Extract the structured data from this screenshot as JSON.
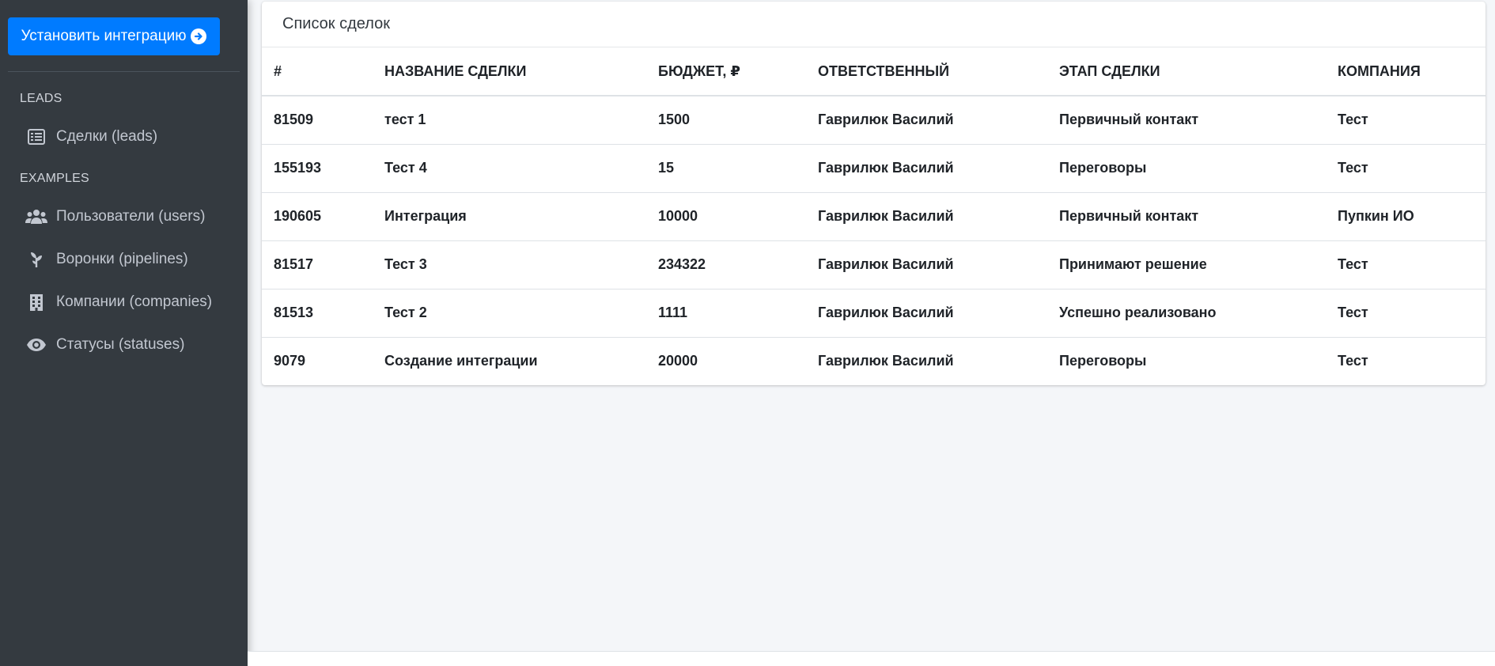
{
  "sidebar": {
    "install_button": "Установить интеграцию",
    "sections": [
      {
        "header": "LEADS",
        "items": [
          {
            "label": "Сделки (leads)",
            "icon": "list-icon"
          }
        ]
      },
      {
        "header": "EXAMPLES",
        "items": [
          {
            "label": "Пользователи (users)",
            "icon": "users-icon"
          },
          {
            "label": "Воронки (pipelines)",
            "icon": "seedling-icon"
          },
          {
            "label": "Компании (companies)",
            "icon": "building-icon"
          },
          {
            "label": "Статусы (statuses)",
            "icon": "eye-icon"
          }
        ]
      }
    ]
  },
  "main": {
    "card_title": "Список сделок",
    "columns": [
      "#",
      "НАЗВАНИЕ СДЕЛКИ",
      "БЮДЖЕТ, ₽",
      "ОТВЕТСТВЕННЫЙ",
      "ЭТАП СДЕЛКИ",
      "КОМПАНИЯ"
    ],
    "rows": [
      [
        "81509",
        "тест 1",
        "1500",
        "Гаврилюк Василий",
        "Первичный контакт",
        "Тест"
      ],
      [
        "155193",
        "Тест 4",
        "15",
        "Гаврилюк Василий",
        "Переговоры",
        "Тест"
      ],
      [
        "190605",
        "Интеграция",
        "10000",
        "Гаврилюк Василий",
        "Первичный контакт",
        "Пупкин ИО"
      ],
      [
        "81517",
        "Тест 3",
        "234322",
        "Гаврилюк Василий",
        "Принимают решение",
        "Тест"
      ],
      [
        "81513",
        "Тест 2",
        "1111",
        "Гаврилюк Василий",
        "Успешно реализовано",
        "Тест"
      ],
      [
        "9079",
        "Создание интеграции",
        "20000",
        "Гаврилюк Василий",
        "Переговоры",
        "Тест"
      ]
    ]
  },
  "colors": {
    "sidebar_bg": "#343a40",
    "primary": "#007bff",
    "content_bg": "#f4f6f9"
  }
}
